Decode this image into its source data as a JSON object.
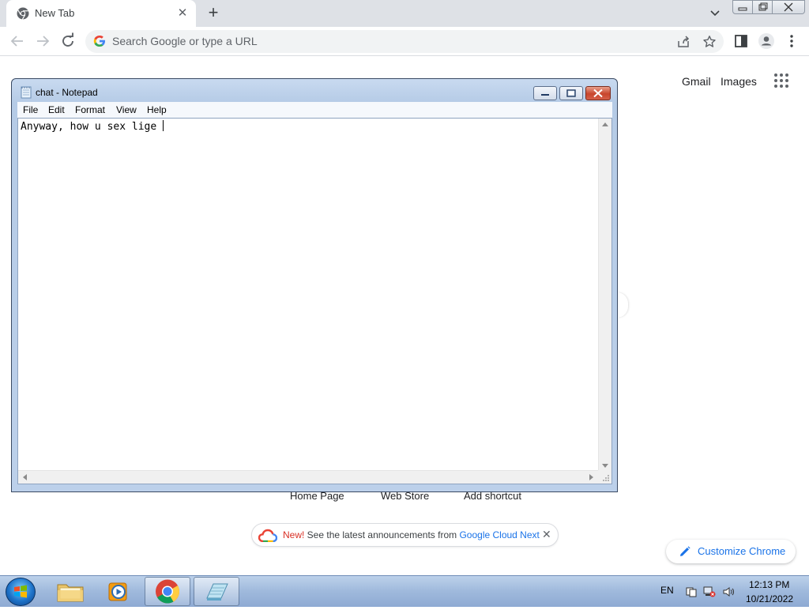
{
  "browser": {
    "tab": {
      "title": "New Tab",
      "close_glyph": "✕"
    },
    "new_tab_glyph": "+",
    "omnibox": {
      "placeholder": "Search Google or type a URL"
    }
  },
  "ntp": {
    "links": {
      "gmail": "Gmail",
      "images": "Images"
    },
    "shortcuts": [
      "Home Page",
      "Web Store",
      "Add shortcut"
    ],
    "promo": {
      "new_label": "New!",
      "text": " See the latest announcements from ",
      "link": "Google Cloud Next",
      "close_glyph": "✕"
    },
    "customize_label": "Customize Chrome"
  },
  "notepad": {
    "title": "chat - Notepad",
    "menu": [
      "File",
      "Edit",
      "Format",
      "View",
      "Help"
    ],
    "content": "Anyway, how u sex lige "
  },
  "taskbar": {
    "language": "EN",
    "time": "12:13 PM",
    "date": "10/21/2022",
    "pinned": [
      "folder-icon",
      "media-player-icon",
      "chrome-icon",
      "notepad-icon"
    ]
  },
  "colors": {
    "accent": "#1a73e8",
    "promo_new": "#d93025",
    "tabstrip": "#dee1e6"
  }
}
